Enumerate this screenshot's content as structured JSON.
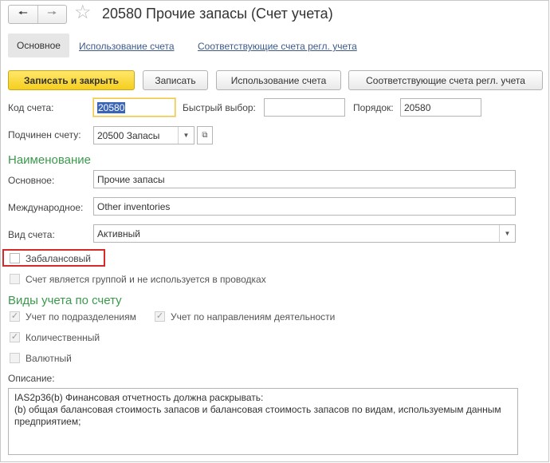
{
  "window": {
    "title": "20580 Прочие запасы (Счет учета)",
    "back_icon": "arrow-left-icon",
    "forward_icon": "arrow-right-icon",
    "favorite_icon": "star-icon"
  },
  "tabs": [
    {
      "label": "Основное",
      "active": true
    },
    {
      "label": "Использование счета",
      "active": false
    },
    {
      "label": "Соответствующие счета регл. учета",
      "active": false
    }
  ],
  "toolbar": {
    "save_close": "Записать и закрыть",
    "save": "Записать",
    "usage": "Использование счета",
    "corresponding": "Соответствующие счета регл. учета"
  },
  "fields": {
    "code_label": "Код счета:",
    "code_value": "20580",
    "quick_label": "Быстрый выбор:",
    "quick_value": "",
    "order_label": "Порядок:",
    "order_value": "20580",
    "parent_label": "Подчинен счету:",
    "parent_value": "20500 Запасы"
  },
  "naming": {
    "header": "Наименование",
    "main_label": "Основное:",
    "main_value": "Прочие запасы",
    "intl_label": "Международное:",
    "intl_value": "Other inventories",
    "type_label": "Вид счета:",
    "type_value": "Активный"
  },
  "flags": {
    "offbalance": {
      "label": "Забалансовый",
      "checked": false
    },
    "is_group": {
      "label": "Счет является группой и не используется в проводках",
      "checked": false
    }
  },
  "accounting": {
    "header": "Виды учета по счету",
    "by_department": {
      "label": "Учет по подразделениям",
      "checked": true
    },
    "by_activity": {
      "label": "Учет по направлениям деятельности",
      "checked": true
    },
    "quantitative": {
      "label": "Количественный",
      "checked": true
    },
    "currency": {
      "label": "Валютный",
      "checked": false
    }
  },
  "description": {
    "label": "Описание:",
    "text": "IAS2p36(b) Финансовая отчетность должна раскрывать:\n(b) общая балансовая стоимость запасов и балансовая стоимость запасов по видам, используемым данным предприятием;"
  },
  "colors": {
    "section_header": "#3a9a4c",
    "primary_button": "#f5ce1e",
    "highlight_border": "#d42a2a",
    "link": "#3d5a8a"
  }
}
